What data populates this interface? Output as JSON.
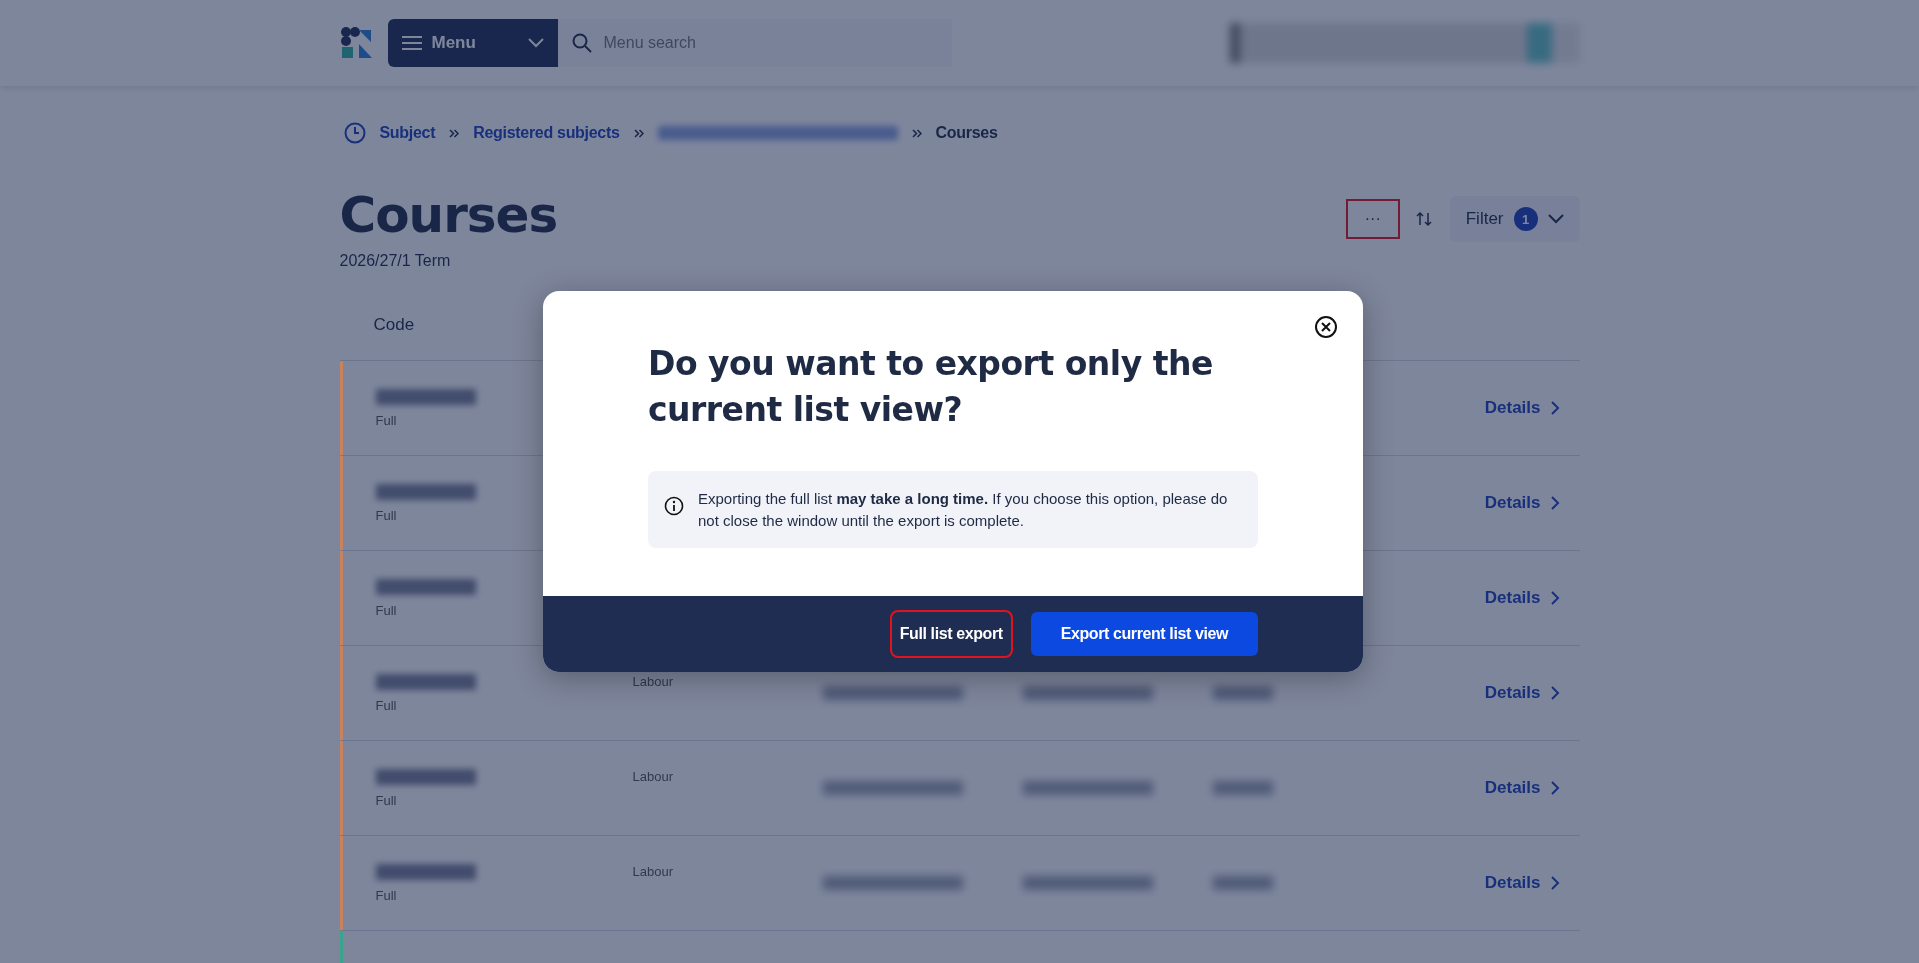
{
  "header": {
    "menu_button": {
      "label": "Menu"
    },
    "search": {
      "placeholder": "Menu search"
    }
  },
  "breadcrumb": [
    {
      "label": "Subject",
      "kind": "link"
    },
    {
      "label": "Registered subjects",
      "kind": "link"
    },
    {
      "kind": "blurred"
    },
    {
      "label": "Courses",
      "kind": "current"
    }
  ],
  "page": {
    "title": "Courses",
    "subtitle": "2026/27/1 Term"
  },
  "toolbar": {
    "more_button": {
      "label": "···",
      "highlighted": true
    },
    "filter": {
      "label": "Filter",
      "badge": "1"
    }
  },
  "table": {
    "columns": [
      "Code"
    ],
    "rows": [
      {
        "type": "Full",
        "color": "#c9825e",
        "link": "Details"
      },
      {
        "type": "Full",
        "color": "#c9825e",
        "link": "Details"
      },
      {
        "type": "Full",
        "color": "#c9825e",
        "link": "Details"
      },
      {
        "type": "Full",
        "column_2": "Labour",
        "color": "#c9825e",
        "link": "Details"
      },
      {
        "type": "Full",
        "column_2": "Labour",
        "color": "#c9825e",
        "link": "Details"
      },
      {
        "type": "Full",
        "column_2": "Labour",
        "color": "#c9825e",
        "link": "Details"
      },
      {
        "color": "#3aa58f"
      }
    ]
  },
  "dialog": {
    "title": "Do you want to export only the current list view?",
    "info": "Exporting the full list **may take a long time.** If you choose this option, please do not close the window until the export is complete.",
    "buttons": [
      {
        "label": "Full list export",
        "kind": "secondary",
        "highlighted": true
      },
      {
        "label": "Export current list view",
        "kind": "primary",
        "highlighted": false
      }
    ]
  }
}
